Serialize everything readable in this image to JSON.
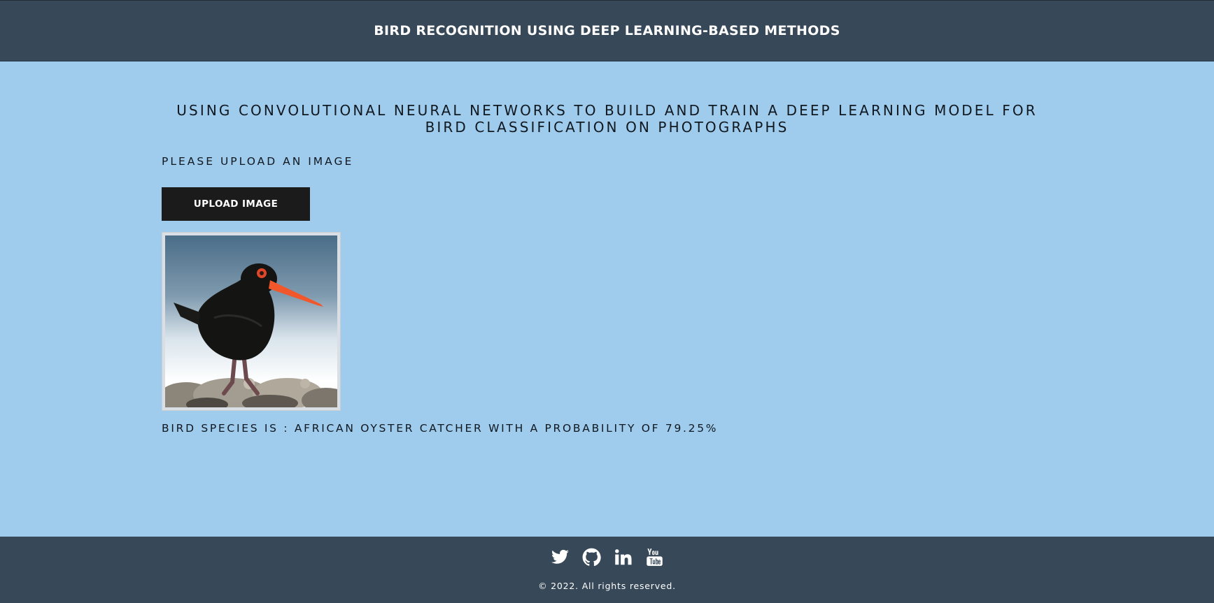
{
  "header": {
    "title": "BIRD RECOGNITION USING DEEP LEARNING-BASED METHODS"
  },
  "main": {
    "heading": "USING CONVOLUTIONAL NEURAL NETWORKS TO BUILD AND TRAIN A DEEP LEARNING MODEL FOR BIRD CLASSIFICATION ON PHOTOGRAPHS",
    "upload_prompt": "PLEASE UPLOAD AN IMAGE",
    "upload_button_label": "UPLOAD IMAGE",
    "uploaded_image": {
      "subject": "black bird with orange beak standing on rocks"
    },
    "result": "BIRD SPECIES IS : AFRICAN OYSTER CATCHER WITH A PROBABILITY OF 79.25%"
  },
  "footer": {
    "social_icons": [
      "twitter-icon",
      "github-icon",
      "linkedin-icon",
      "youtube-icon"
    ],
    "copyright": "© 2022. All rights reserved."
  },
  "colors": {
    "header_bg": "#374858",
    "page_bg": "#9fcbec",
    "button_bg": "#1b1b1b",
    "footer_bg": "#374858",
    "bird_beak": "#f1572b"
  }
}
